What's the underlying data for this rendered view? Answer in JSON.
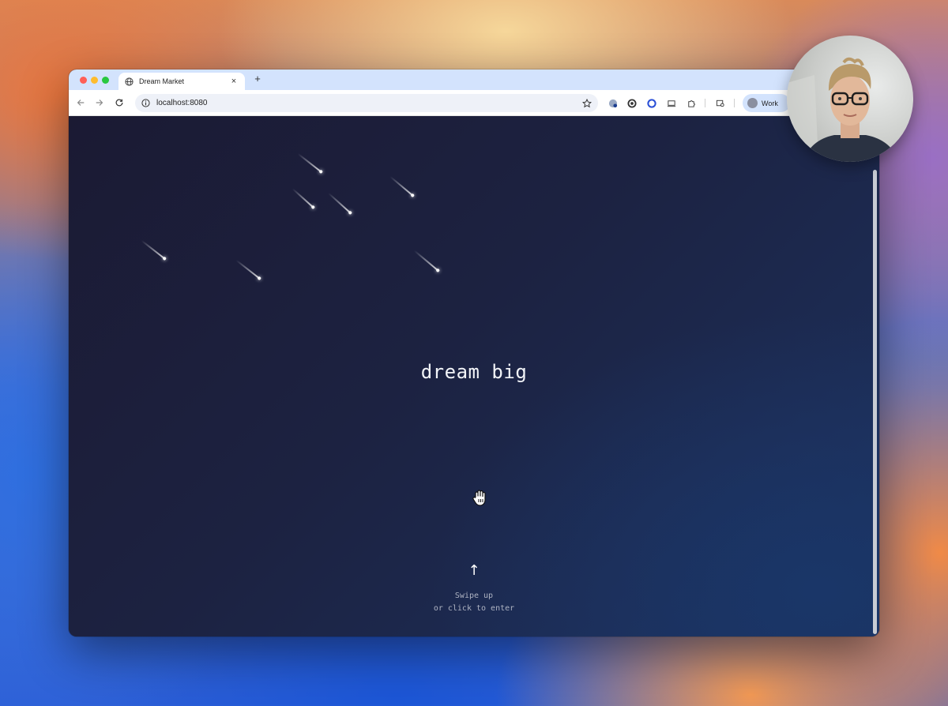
{
  "browser": {
    "tab_title": "Dream Market",
    "tab_close": "×",
    "new_tab": "+",
    "url": "localhost:8080",
    "profile_label": "Work"
  },
  "page": {
    "headline": "dream big",
    "arrow": "↑",
    "hint_line1": "Swipe up",
    "hint_line2": "or click to enter"
  },
  "colors": {
    "tab_strip": "#d3e3fd",
    "page_bg_start": "#1b1a33",
    "page_bg_end": "#1d3260"
  }
}
